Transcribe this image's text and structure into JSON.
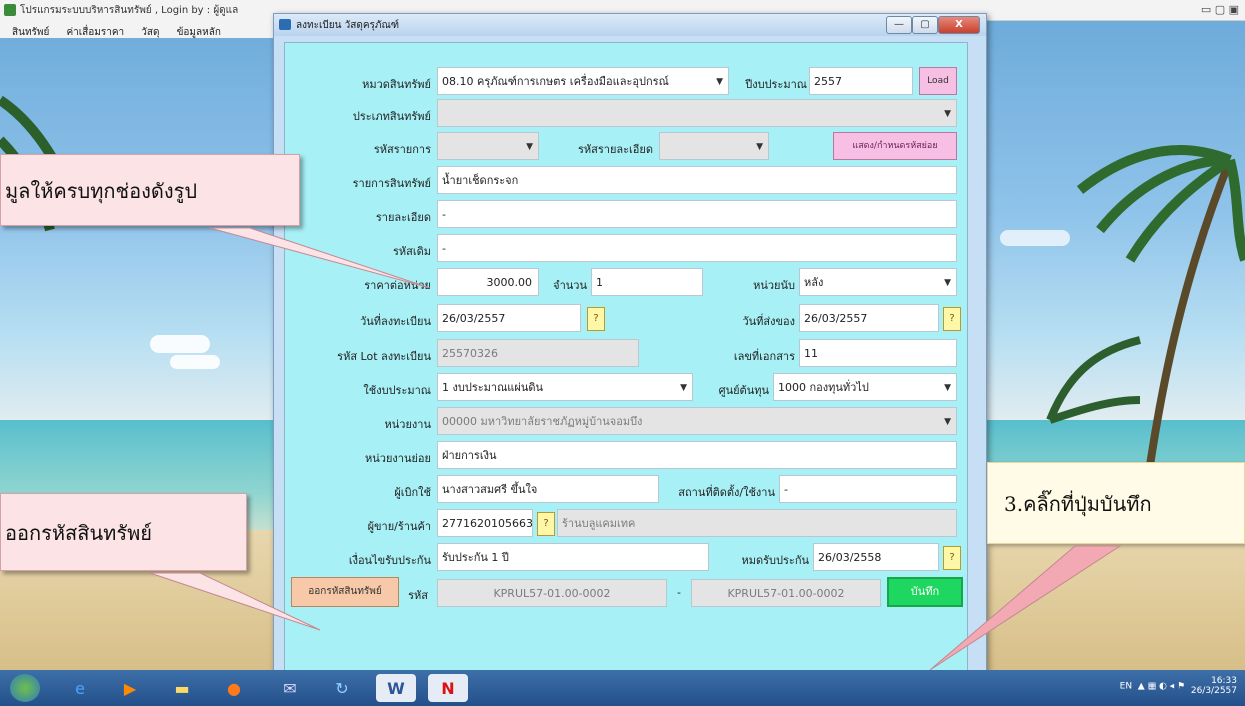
{
  "main_window": {
    "title": "โปรแกรมระบบบริหารสินทรัพย์ , Login by : ผู้ดูแล",
    "controls": "▭  ▢  ▣",
    "menu": [
      "สินทรัพย์",
      "ค่าเสื่อมราคา",
      "วัสดุ",
      "ข้อมูลหลัก"
    ]
  },
  "dialog": {
    "title": "ลงทะเบียน วัสดุครุภัณฑ์",
    "btn_min": "—",
    "btn_max": "▢",
    "btn_close": "X"
  },
  "form": {
    "asset_category_label": "หมวดสินทรัพย์",
    "asset_category_value": "08.10 ครุภัณฑ์การเกษตร เครื่องมือและอุปกรณ์",
    "fiscal_year_label": "ปีงบประมาณ",
    "fiscal_year_value": "2557",
    "load_button": "Load",
    "asset_type_label": "ประเภทสินทรัพย์",
    "asset_type_value": "",
    "item_code_label": "รหัสรายการ",
    "detail_code_label": "รหัสรายละเอียด",
    "show_code_button": "แสดง/กำหนดรหัสย่อย",
    "item_name_label": "รายการสินทรัพย์",
    "item_name_value": "น้ำยาเช็ดกระจก",
    "detail_label": "รายละเอียด",
    "detail_value": "-",
    "old_code_label": "รหัสเดิม",
    "old_code_value": "-",
    "unit_price_label": "ราคาต่อหน่วย",
    "unit_price_value": "3000.00",
    "quantity_label": "จำนวน",
    "quantity_value": "1",
    "unit_label": "หน่วยนับ",
    "unit_value": "หลัง",
    "reg_date_label": "วันที่ลงทะเบียน",
    "reg_date_value": "26/03/2557",
    "delivery_date_label": "วันที่ส่งของ",
    "delivery_date_value": "26/03/2557",
    "lot_label": "รหัส Lot ลงทะเบียน",
    "lot_value": "25570326",
    "doc_no_label": "เลขที่เอกสาร",
    "doc_no_value": "11",
    "budget_label": "ใช้งบประมาณ",
    "budget_value": "1 งบประมาณแผ่นดิน",
    "cost_center_label": "ศูนย์ต้นทุน",
    "cost_center_value": "1000 กองทุนทั่วไป",
    "agency_label": "หน่วยงาน",
    "agency_value": "00000 มหาวิทยาลัยราชภัฏหมู่บ้านจอมบึง",
    "sub_agency_label": "หน่วยงานย่อย",
    "sub_agency_value": "ฝ่ายการเงิน",
    "user_label": "ผู้เบิกใช้",
    "user_value": "นางสาวสมศรี ขึ้นใจ",
    "location_label": "สถานที่ติดตั้ง/ใช้งาน",
    "location_value": "-",
    "vendor_label": "ผู้ขาย/ร้านค้า",
    "vendor_code": "2771620105663",
    "vendor_name": "ร้านบลูแคมเทค",
    "warranty_label": "เงื่อนไขรับประกัน",
    "warranty_value": "รับประกัน 1 ปี",
    "warranty_end_label": "หมดรับประกัน",
    "warranty_end_value": "26/03/2558",
    "gen_code_button": "ออกรหัสสินทรัพย์",
    "code_label": "รหัส",
    "code_from": "KPRUL57-01.00-0002",
    "code_sep": "-",
    "code_to": "KPRUL57-01.00-0002",
    "save_button": "บันทึก",
    "cal_glyph": "?"
  },
  "callouts": {
    "c1": "มูลให้ครบทุกช่องดังรูป",
    "c2": "ออกรหัสสินทรัพย์",
    "c3": "3.คลิ๊กที่ปุ่มบันทึก"
  },
  "tray": {
    "lang": "EN",
    "time": "16:33",
    "date": "26/3/2557"
  },
  "colors": {
    "form_bg": "#a7f0f6",
    "save_green": "#1ed760",
    "load_pink": "#f7bfe4",
    "callout_pink": "#fbe3e6"
  }
}
